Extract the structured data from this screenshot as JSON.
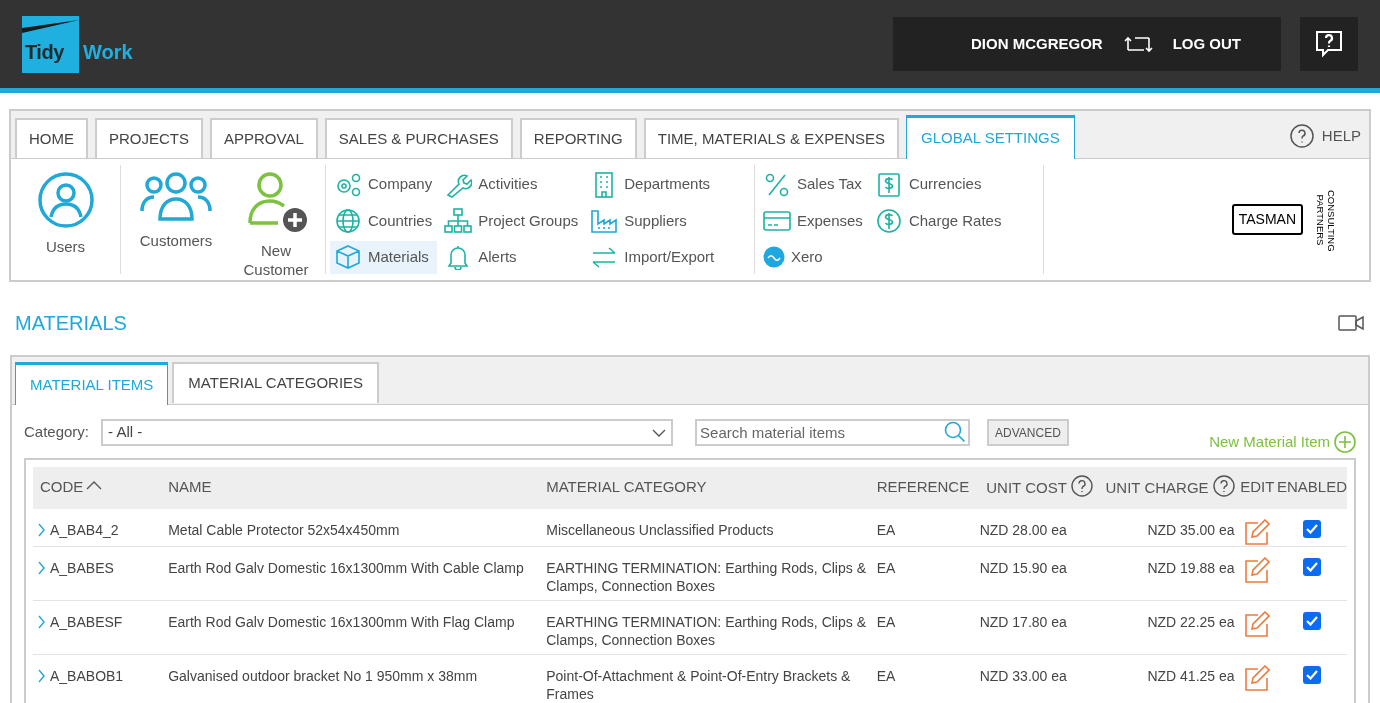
{
  "header": {
    "logo": {
      "first": "Tidy",
      "second": "Work"
    },
    "user": "DION MCGREGOR",
    "logout": "LOG OUT"
  },
  "nav": {
    "tabs": [
      {
        "label": "HOME",
        "selected": false
      },
      {
        "label": "PROJECTS",
        "selected": false
      },
      {
        "label": "APPROVAL",
        "selected": false
      },
      {
        "label": "SALES & PURCHASES",
        "selected": false
      },
      {
        "label": "REPORTING",
        "selected": false
      },
      {
        "label": "TIME, MATERIALS & EXPENSES",
        "selected": false
      },
      {
        "label": "GLOBAL SETTINGS",
        "selected": true
      }
    ],
    "help": "HELP",
    "big_items": [
      {
        "label": "Users"
      },
      {
        "label": "Customers"
      },
      {
        "label": "New Customer"
      }
    ],
    "groups": [
      {
        "items": [
          {
            "label": "Company",
            "selected": false
          },
          {
            "label": "Countries",
            "selected": false
          },
          {
            "label": "Materials",
            "selected": true
          },
          {
            "label": "Activities",
            "selected": false
          },
          {
            "label": "Project Groups",
            "selected": false
          },
          {
            "label": "Alerts",
            "selected": false
          },
          {
            "label": "Departments",
            "selected": false
          },
          {
            "label": "Suppliers",
            "selected": false
          },
          {
            "label": "Import/Export",
            "selected": false
          }
        ]
      },
      {
        "items": [
          {
            "label": "Sales Tax",
            "selected": false
          },
          {
            "label": "Expenses",
            "selected": false
          },
          {
            "label": "Xero",
            "selected": false
          },
          {
            "label": "Currencies",
            "selected": false
          },
          {
            "label": "Charge Rates",
            "selected": false
          }
        ]
      }
    ],
    "partner_logo": {
      "name": "TASMAN",
      "tagline": "CONSULTING PARTNERS"
    }
  },
  "page": {
    "title": "MATERIALS",
    "tabs": [
      {
        "label": "MATERIAL ITEMS",
        "selected": true
      },
      {
        "label": "MATERIAL CATEGORIES",
        "selected": false
      }
    ],
    "filter": {
      "label": "Category:",
      "value": "- All -",
      "search_placeholder": "Search material items",
      "advanced": "ADVANCED",
      "new_item": "New Material Item"
    },
    "table": {
      "columns": [
        "CODE",
        "NAME",
        "MATERIAL CATEGORY",
        "REFERENCE",
        "UNIT COST",
        "UNIT CHARGE",
        "EDIT",
        "ENABLED"
      ],
      "rows": [
        {
          "code": "A_BAB4_2",
          "name": "Metal Cable Protector 52x54x450mm",
          "category": "Miscellaneous Unclassified Products",
          "reference": "EA",
          "unit_cost": "NZD 28.00 ea",
          "unit_charge": "NZD 35.00 ea",
          "enabled": true
        },
        {
          "code": "A_BABES",
          "name": "Earth Rod Galv Domestic 16x1300mm With Cable Clamp",
          "category": "EARTHING TERMINATION: Earthing Rods, Clips & Clamps, Connection Boxes",
          "reference": "EA",
          "unit_cost": "NZD 15.90 ea",
          "unit_charge": "NZD 19.88 ea",
          "enabled": true
        },
        {
          "code": "A_BABESF",
          "name": "Earth Rod Galv Domestic 16x1300mm With Flag Clamp",
          "category": "EARTHING TERMINATION: Earthing Rods, Clips & Clamps, Connection Boxes",
          "reference": "EA",
          "unit_cost": "NZD 17.80 ea",
          "unit_charge": "NZD 22.25 ea",
          "enabled": true
        },
        {
          "code": "A_BABOB1",
          "name": "Galvanised outdoor bracket No 1 950mm x 38mm",
          "category": "Point-Of-Attachment & Point-Of-Entry Brackets & Frames",
          "reference": "EA",
          "unit_cost": "NZD 33.00 ea",
          "unit_charge": "NZD 41.25 ea",
          "enabled": true
        }
      ]
    }
  }
}
